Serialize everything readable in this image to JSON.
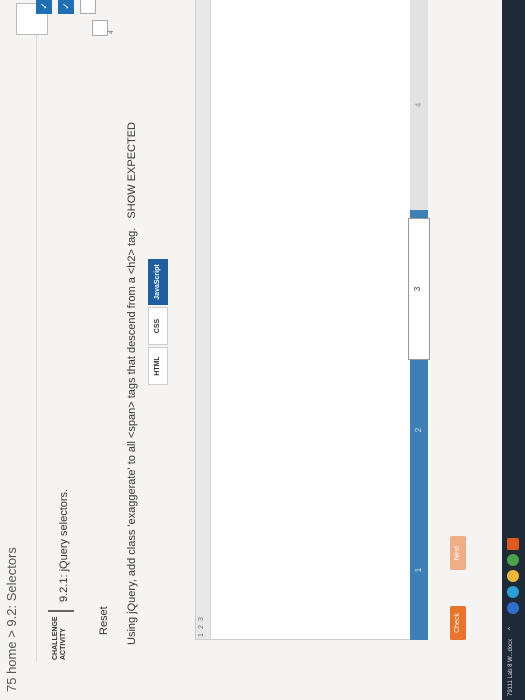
{
  "breadcrumb": "75 home > 9.2: Selectors",
  "challenge": {
    "tag_line1": "CHALLENGE",
    "tag_line2": "ACTIVITY",
    "title": "9.2.1: jQuery selectors."
  },
  "reset_label": "Reset",
  "instructions": "Using jQuery, add class 'exaggerate' to all <span> tags that descend from a <h2> tag.",
  "show_expected_label": "SHOW EXPECTED",
  "tabs": [
    {
      "label": "HTML",
      "active": false
    },
    {
      "label": "CSS",
      "active": false
    },
    {
      "label": "JavaScript",
      "active": true
    }
  ],
  "editor": {
    "line_numbers": [
      "1",
      "2",
      "3"
    ]
  },
  "progress": {
    "items": [
      {
        "label": "1",
        "done": true
      },
      {
        "label": "2",
        "done": true
      },
      {
        "label": "3",
        "done": false
      },
      {
        "label": "4",
        "done": false
      }
    ],
    "check_mark": "✓"
  },
  "steps": [
    {
      "label": "1",
      "state": "done"
    },
    {
      "label": "2",
      "state": "done"
    },
    {
      "label": "3",
      "state": "current"
    },
    {
      "label": "4",
      "state": "future"
    }
  ],
  "buttons": {
    "check": "Check",
    "next": "Next"
  },
  "taskbar": {
    "item_label": "79111 Lab 8 W...docx",
    "chevron": "^"
  }
}
